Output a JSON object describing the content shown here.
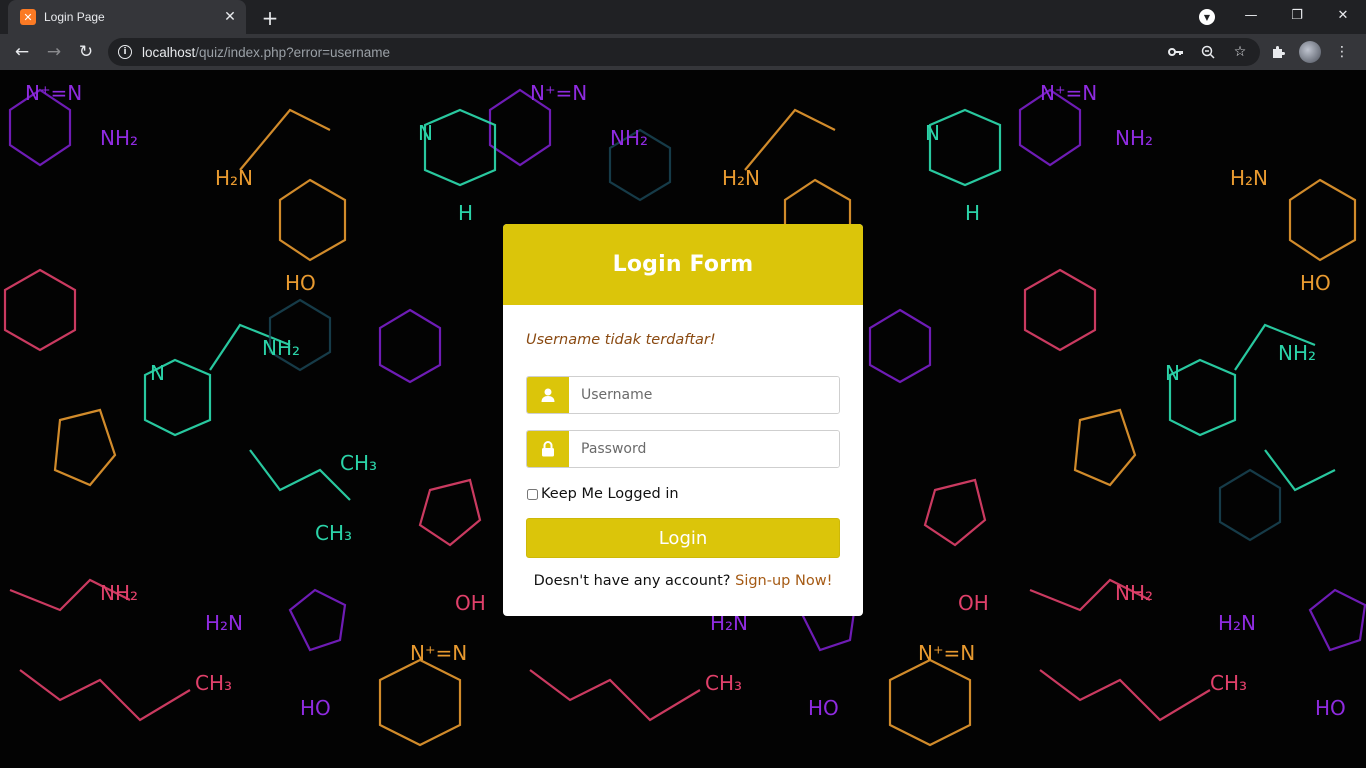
{
  "browser": {
    "tab_title": "Login Page",
    "tab_favicon": "xampp-icon",
    "url_host": "localhost",
    "url_path": "/quiz/index.php?error=username"
  },
  "login": {
    "title": "Login Form",
    "error_message": "Username tidak terdaftar!",
    "username_placeholder": "Username",
    "password_placeholder": "Password",
    "remember_label": "Keep Me Logged in",
    "login_button": "Login",
    "signup_prompt": "Doesn't have any account?",
    "signup_link": "Sign-up Now!"
  },
  "colors": {
    "accent": "#dbc50a",
    "error_text": "#8a4a12",
    "link": "#a55a14",
    "background": "#030303"
  }
}
